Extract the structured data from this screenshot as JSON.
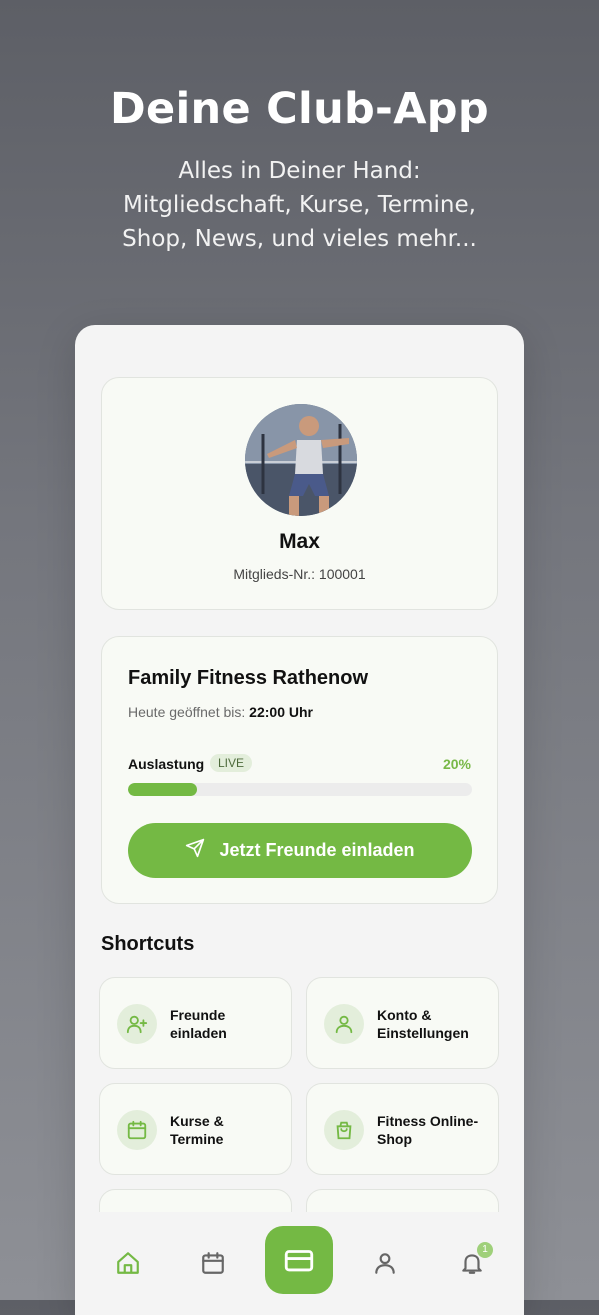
{
  "hero": {
    "title": "Deine Club-App",
    "subtitle_lines": [
      "Alles in Deiner Hand:",
      "Mitgliedschaft, Kurse, Termine,",
      "Shop, News, und vieles mehr..."
    ]
  },
  "profile": {
    "name": "Max",
    "member_nr": "Mitglieds-Nr.: 100001"
  },
  "studio": {
    "name": "Family Fitness Rathenow",
    "open_label": "Heute geöffnet bis:",
    "open_time": "22:00 Uhr",
    "load_label": "Auslastung",
    "live_label": "LIVE",
    "load_percent_text": "20%",
    "load_fraction": 0.2,
    "invite_button": "Jetzt Freunde einladen"
  },
  "shortcuts": {
    "title": "Shortcuts",
    "items": [
      {
        "lines": [
          "Freunde",
          "einladen"
        ],
        "icon": "user-plus-icon"
      },
      {
        "lines": [
          "Konto &",
          "Einstellungen"
        ],
        "icon": "user-icon"
      },
      {
        "lines": [
          "Kurse &",
          "Termine"
        ],
        "icon": "calendar-icon"
      },
      {
        "lines": [
          "Fitness Online-",
          "Shop"
        ],
        "icon": "shopping-bag-icon"
      }
    ]
  },
  "nav": {
    "items": [
      "home-icon",
      "calendar-icon",
      "card-icon",
      "user-icon",
      "bell-icon"
    ],
    "notification_count": "1"
  },
  "colors": {
    "accent": "#74b944",
    "accent_light": "#e3eedb"
  }
}
